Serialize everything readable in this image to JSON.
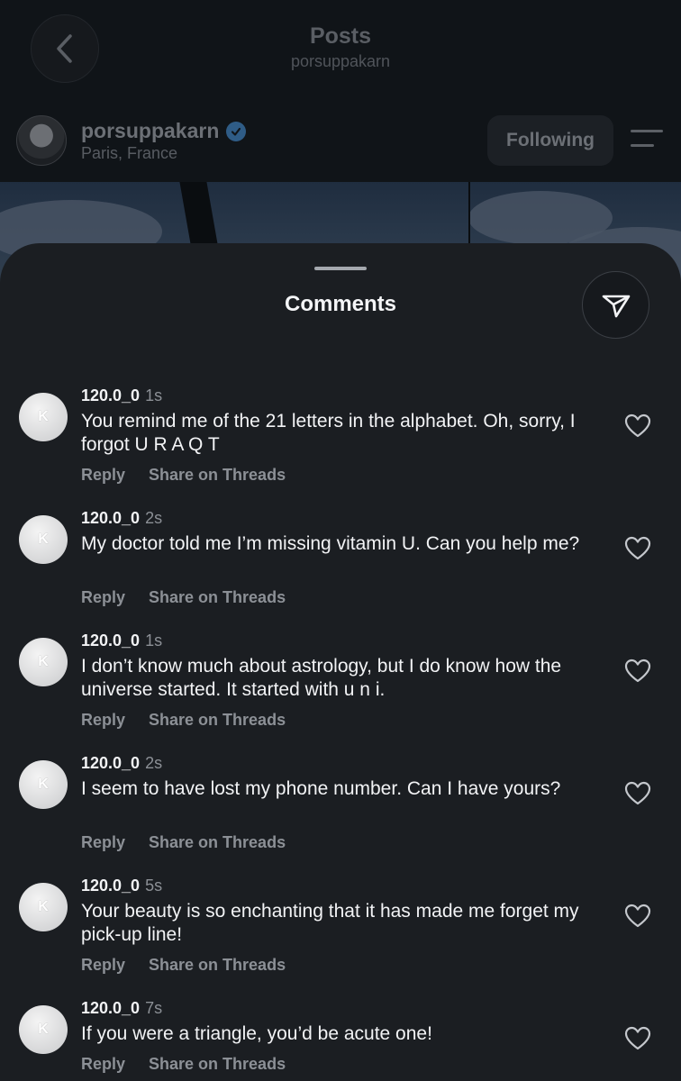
{
  "nav": {
    "title": "Posts",
    "subtitle": "porsuppakarn"
  },
  "post": {
    "username": "porsuppakarn",
    "location": "Paris, France",
    "verified": true,
    "following_label": "Following"
  },
  "comments_sheet": {
    "title": "Comments",
    "items": [
      {
        "avatar_letter": "K",
        "username": "120.0_0",
        "time": "1s",
        "text": "You remind me of the 21 letters in the alphabet. Oh, sorry, I forgot U R A Q T",
        "reply_label": "Reply",
        "share_label": "Share on Threads"
      },
      {
        "avatar_letter": "K",
        "username": "120.0_0",
        "time": "2s",
        "text": "My doctor told me I’m missing vitamin U. Can you help me?",
        "reply_label": "Reply",
        "share_label": "Share on Threads"
      },
      {
        "avatar_letter": "K",
        "username": "120.0_0",
        "time": "1s",
        "text": "I don’t know much about astrology, but I do know how the universe started. It started with u n i.",
        "reply_label": "Reply",
        "share_label": "Share on Threads"
      },
      {
        "avatar_letter": "K",
        "username": "120.0_0",
        "time": "2s",
        "text": "I seem to have lost my phone number. Can I have yours?",
        "reply_label": "Reply",
        "share_label": "Share on Threads"
      },
      {
        "avatar_letter": "K",
        "username": "120.0_0",
        "time": "5s",
        "text": "Your beauty is so enchanting that it has made me forget my pick-up line!",
        "reply_label": "Reply",
        "share_label": "Share on Threads"
      },
      {
        "avatar_letter": "K",
        "username": "120.0_0",
        "time": "7s",
        "text": "If you were a triangle, you’d be acute one!",
        "reply_label": "Reply",
        "share_label": "Share on Threads"
      }
    ]
  },
  "icons": {
    "back": "chevron-left-icon",
    "verified": "verified-badge-icon",
    "menu": "menu-icon",
    "send": "send-icon",
    "like": "heart-icon"
  },
  "colors": {
    "sheet_background": "#1b1e22",
    "page_background": "#101418",
    "primary_text": "#f2f3f5",
    "secondary_text": "#8c9096",
    "verified_badge": "#2f5c86"
  }
}
